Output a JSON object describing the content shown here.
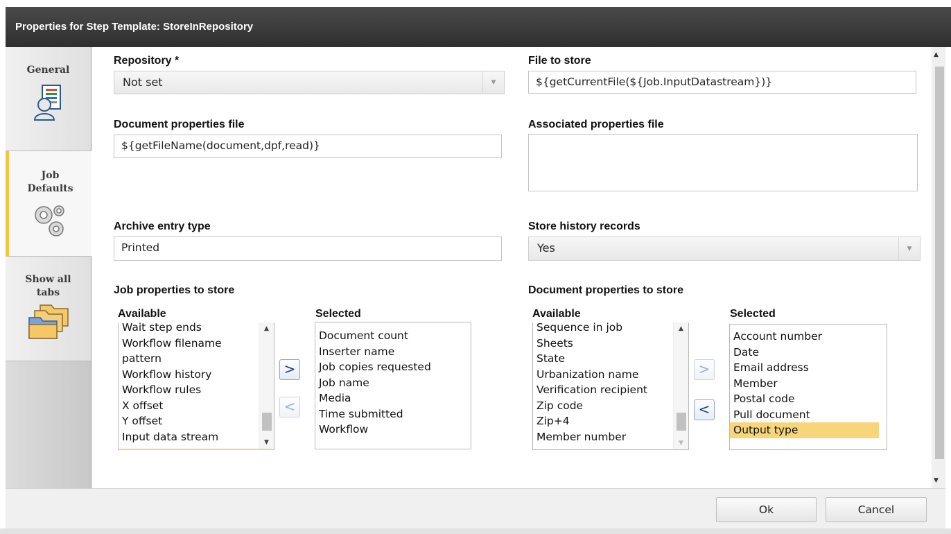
{
  "window": {
    "title": "Properties for Step Template: StoreInRepository"
  },
  "tabs": [
    {
      "label": "General",
      "icon": "user-document-icon"
    },
    {
      "label": "Job Defaults",
      "icon": "gears-icon"
    },
    {
      "label": "Show all tabs",
      "icon": "folders-icon"
    }
  ],
  "active_tab": "Job Defaults",
  "form": {
    "repository": {
      "label": "Repository *",
      "value": "Not set"
    },
    "file_to_store": {
      "label": "File to store",
      "value": "${getCurrentFile(${Job.InputDatastream})}"
    },
    "document_properties_file": {
      "label": "Document properties file",
      "value": "${getFileName(document,dpf,read)}"
    },
    "associated_properties_file": {
      "label": "Associated properties file",
      "value": ""
    },
    "archive_entry_type": {
      "label": "Archive entry type",
      "value": "Printed"
    },
    "store_history_records": {
      "label": "Store history records",
      "value": "Yes"
    }
  },
  "job_properties": {
    "title": "Job properties to store",
    "available_label": "Available",
    "selected_label": "Selected",
    "available": [
      "Wait step ends",
      "Workflow filename",
      "pattern",
      "Workflow history",
      "Workflow rules",
      "X offset",
      "Y offset",
      "Input data stream"
    ],
    "selected": [
      "Document count",
      "Inserter name",
      "Job copies requested",
      "Job name",
      "Media",
      "Time submitted",
      "Workflow"
    ],
    "add_arrow": ">",
    "remove_arrow": "<"
  },
  "document_properties": {
    "title": "Document properties to store",
    "available_label": "Available",
    "selected_label": "Selected",
    "available": [
      "Sequence in job",
      "Sheets",
      "State",
      "Urbanization name",
      "Verification recipient",
      "Zip code",
      "Zip+4",
      "Member number"
    ],
    "selected": [
      "Account number",
      "Date",
      "Email address",
      "Member",
      "Postal code",
      "Pull document",
      "Output type"
    ],
    "selected_highlight": "Output type",
    "add_arrow": ">",
    "remove_arrow": "<"
  },
  "buttons": {
    "ok": "Ok",
    "cancel": "Cancel"
  },
  "colors": {
    "active_tab_accent": "#f4c63c",
    "selection": "#f7d57a",
    "titlebar": "#3a3a3a"
  }
}
